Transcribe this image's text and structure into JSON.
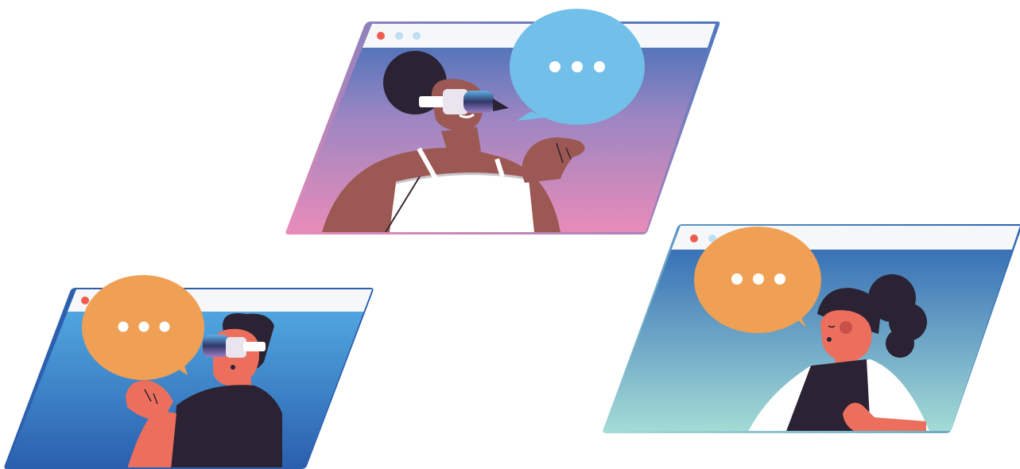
{
  "scene": {
    "description_label": "",
    "windows": [
      {
        "id": "top",
        "gradient": [
          "#3d6fb8",
          "#9d86c2",
          "#e98cb8"
        ],
        "frame_color": "#c27fb6",
        "titlebar": "#f6f7f9",
        "dots": [
          "#ee5b4f",
          "#bfe0f4",
          "#bfe0f4"
        ],
        "bubble_color": "#72c0ea",
        "bubble_dots": "#ffffff",
        "skin": "#9c5852",
        "hair": "#2b2233",
        "headset": "vr-headset-icon"
      },
      {
        "id": "left",
        "gradient": [
          "#4fa8e0",
          "#2a63b2"
        ],
        "frame_color": "#2c5fae",
        "titlebar": "#f6f7f9",
        "dots": [
          "#ee5b4f",
          "#bfe0f4",
          "#bfe0f4"
        ],
        "bubble_color": "#f0a055",
        "bubble_dots": "#ffffff",
        "skin": "#ec6f5d",
        "hair": "#2b2233",
        "headset": "vr-headset-icon"
      },
      {
        "id": "right",
        "gradient": [
          "#2a63b2",
          "#9fd6d8"
        ],
        "frame_color": "#6fb7d4",
        "titlebar": "#f6f7f9",
        "dots": [
          "#ee5b4f",
          "#bfe0f4"
        ],
        "bubble_color": "#f0a055",
        "bubble_dots": "#ffffff",
        "skin": "#ec6f5d",
        "hair": "#2b2233"
      }
    ]
  }
}
